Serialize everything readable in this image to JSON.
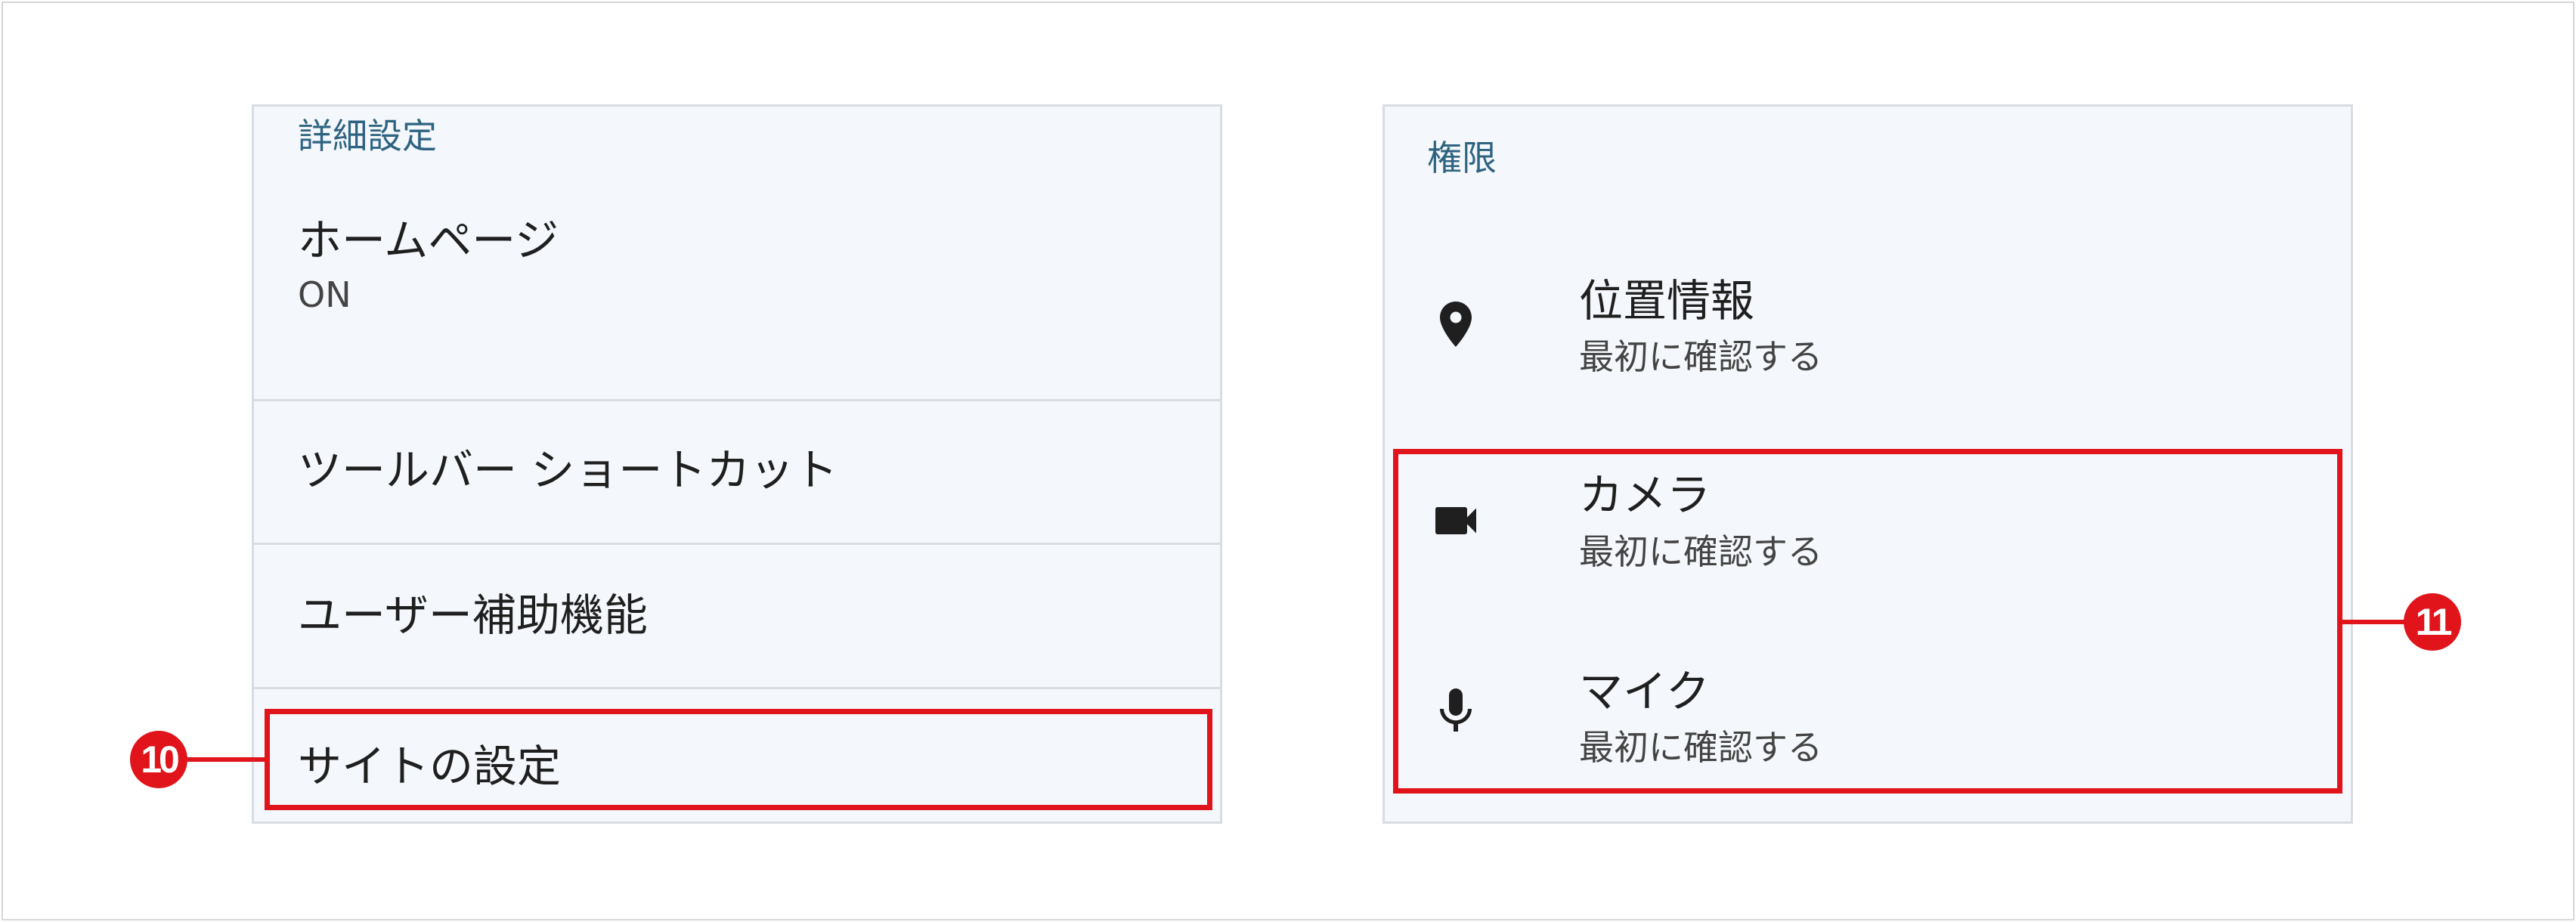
{
  "left_panel": {
    "section_title": "詳細設定",
    "items": [
      {
        "title": "ホームページ",
        "subtitle": "ON"
      },
      {
        "title": "ツールバー ショートカット"
      },
      {
        "title": "ユーザー補助機能"
      },
      {
        "title": "サイトの設定"
      }
    ]
  },
  "right_panel": {
    "section_title": "権限",
    "items": [
      {
        "title": "位置情報",
        "subtitle": "最初に確認する",
        "icon": "location-pin-icon"
      },
      {
        "title": "カメラ",
        "subtitle": "最初に確認する",
        "icon": "video-camera-icon"
      },
      {
        "title": "マイク",
        "subtitle": "最初に確認する",
        "icon": "microphone-icon"
      }
    ]
  },
  "annotations": {
    "callout_10": "10",
    "callout_11": "11",
    "accent_color": "#e1141b"
  }
}
